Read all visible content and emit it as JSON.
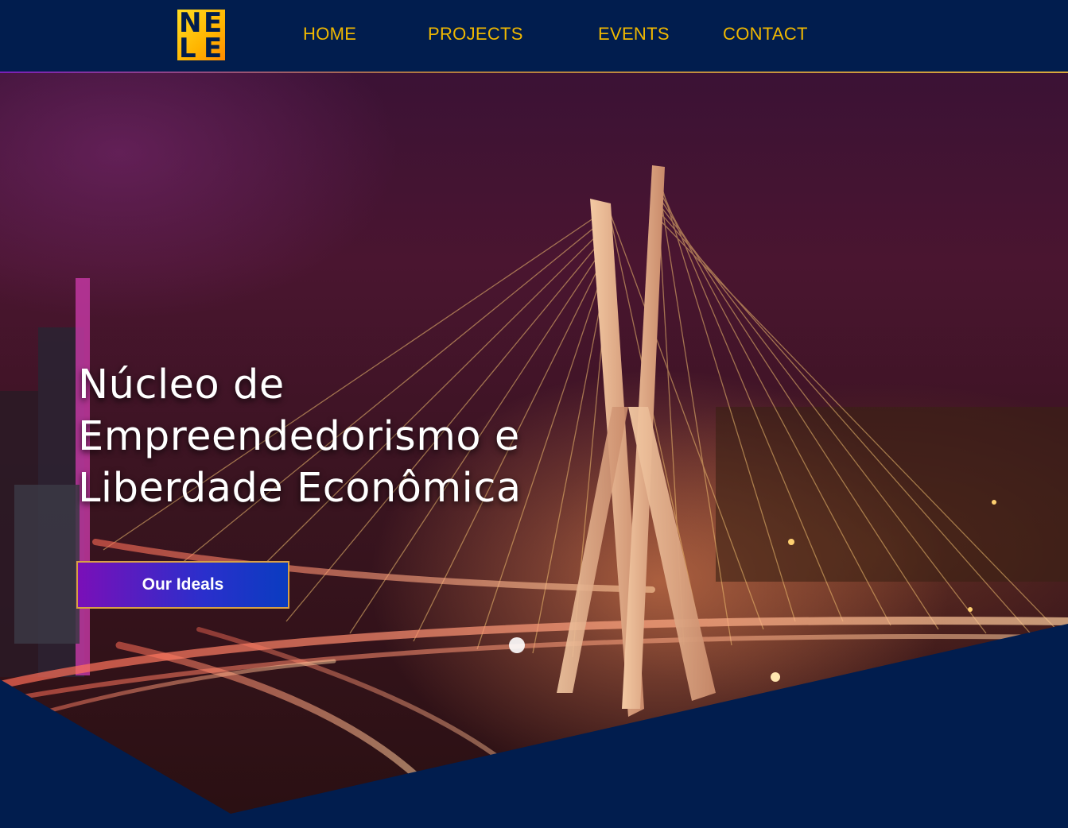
{
  "header": {
    "logo": {
      "letters": [
        "N",
        "E",
        "L",
        "E"
      ],
      "alt": "NELE logo"
    },
    "nav": [
      {
        "label": "HOME"
      },
      {
        "label": "PROJECTS"
      },
      {
        "label": "EVENTS"
      },
      {
        "label": "CONTACT"
      }
    ]
  },
  "hero": {
    "title_lines": [
      "Núcleo de",
      "Empreendedorismo e",
      "Liberdade Econômica"
    ],
    "cta_label": "Our Ideals",
    "background_description_icon": "night-bridge-photo"
  },
  "colors": {
    "navy": "#011d4e",
    "nav_text": "#f0b800",
    "logo_yellow": "#ffcc00",
    "cta_purple": "#7a0fb8",
    "cta_blue": "#0a3cc0",
    "cta_border": "#d8a045"
  }
}
